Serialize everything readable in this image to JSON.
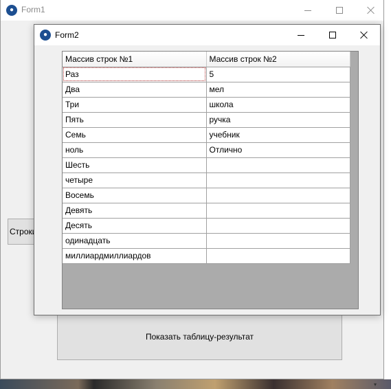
{
  "form1": {
    "title": "Form1",
    "rows_button_label": "Строки",
    "result_button_label": "Показать таблицу-результат"
  },
  "form2": {
    "title": "Form2",
    "grid": {
      "columns": [
        "Массив строк  №1",
        "Массив строк  №2"
      ],
      "rows": [
        [
          "Раз",
          "5"
        ],
        [
          "Два",
          "мел"
        ],
        [
          "Три",
          "школа"
        ],
        [
          "Пять",
          "ручка"
        ],
        [
          "Семь",
          "учебник"
        ],
        [
          "ноль",
          "Отлично"
        ],
        [
          "Шесть",
          ""
        ],
        [
          "четыре",
          ""
        ],
        [
          "Восемь",
          ""
        ],
        [
          "Девять",
          ""
        ],
        [
          "Десять",
          ""
        ],
        [
          "одинадцать",
          ""
        ],
        [
          "миллиардмиллиардов",
          ""
        ]
      ]
    }
  },
  "icons": {
    "app_icon": "paw-icon",
    "minimize": "minimize-icon",
    "maximize": "maximize-icon",
    "close": "close-icon"
  },
  "colors": {
    "window_bg": "#f0f0f0",
    "button_bg": "#e1e1e1",
    "grid_bg": "#ababab",
    "current_cell_outline": "#b03030"
  }
}
